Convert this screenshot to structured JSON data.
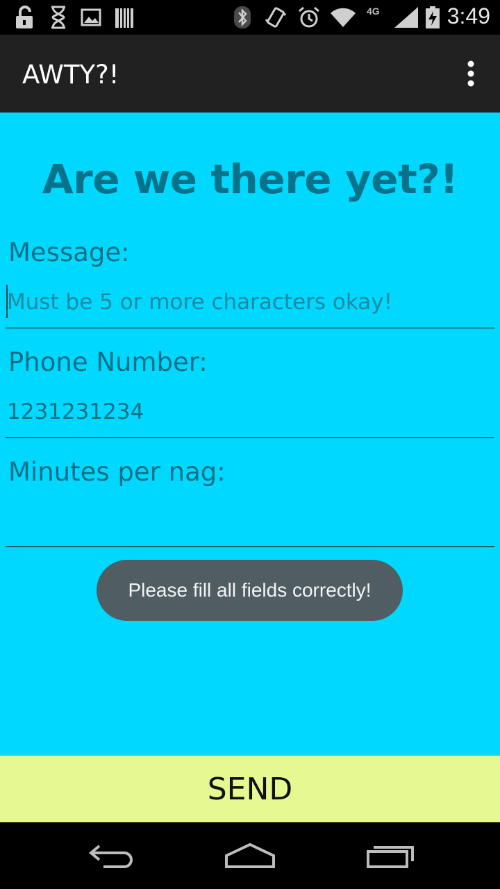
{
  "status_bar": {
    "time": "3:49",
    "network": "4G",
    "icons": [
      "unlock-icon",
      "hourglass-icon",
      "image-icon",
      "barcode-icon",
      "bluetooth-icon",
      "vibrate-icon",
      "alarm-icon",
      "wifi-icon",
      "signal-icon",
      "battery-charging-icon"
    ]
  },
  "action_bar": {
    "title": "AWTY?!",
    "overflow_icon": "more-vert-icon"
  },
  "form": {
    "heading": "Are we there yet?!",
    "message_label": "Message:",
    "message_placeholder": "Must be 5 or more characters okay!",
    "message_value": "",
    "phone_label": "Phone Number:",
    "phone_value": "1231231234",
    "minutes_label": "Minutes per nag:",
    "minutes_value": ""
  },
  "toast": {
    "text": "Please fill all fields correctly!"
  },
  "send_button": {
    "label": "SEND"
  },
  "nav_bar": {
    "icons": [
      "back-icon",
      "home-icon",
      "recents-icon"
    ]
  },
  "colors": {
    "background": "#00d8ff",
    "action_bar": "#212121",
    "heading_text": "#07738a",
    "send_button_bg": "#e6f892",
    "toast_bg": "#505e64"
  }
}
